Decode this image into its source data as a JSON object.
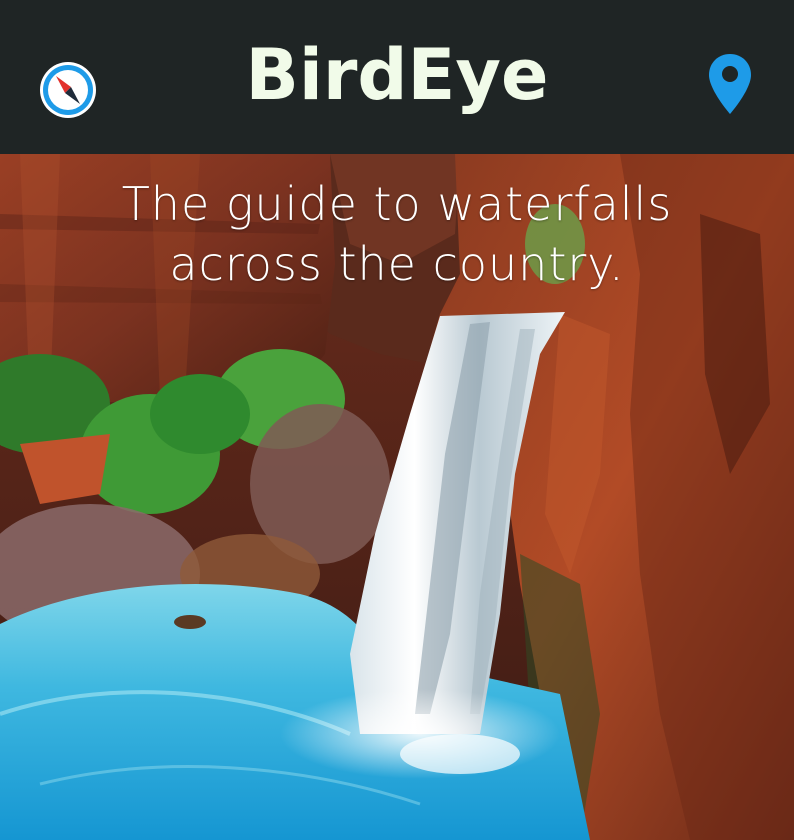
{
  "app": {
    "title": "BirdEye"
  },
  "header": {
    "left_icon": "compass-icon",
    "right_icon": "location-pin-icon",
    "accent_color": "#1e9be8",
    "background_color": "#1f2525",
    "title_color": "#f1fbe9"
  },
  "hero": {
    "tagline_line1": "The guide to waterfalls",
    "tagline_line2": "across the country.",
    "image_subject": "waterfall"
  }
}
